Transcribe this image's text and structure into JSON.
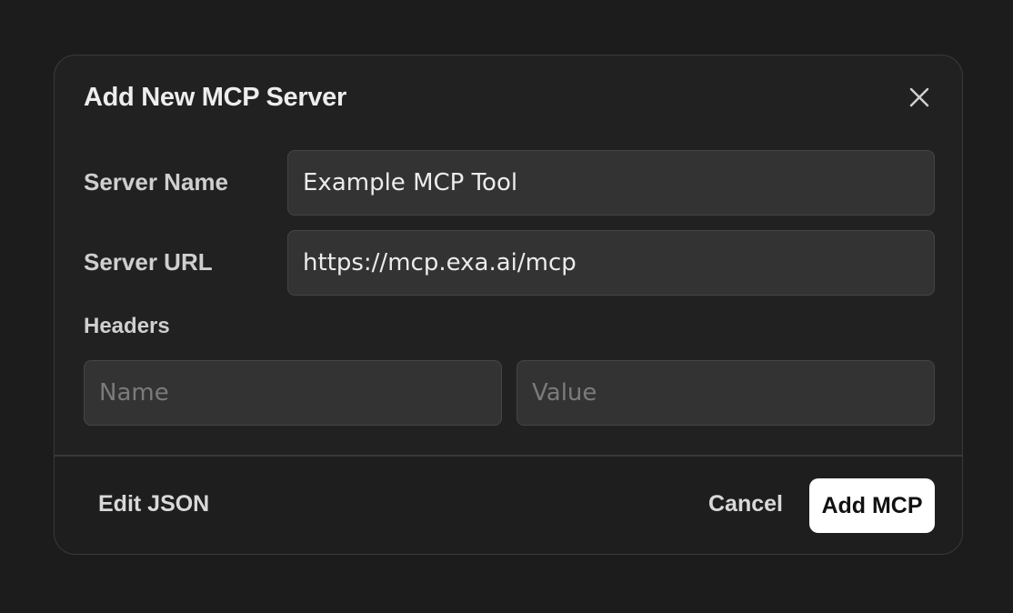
{
  "dialog": {
    "title": "Add New MCP Server",
    "close_icon": "close-icon"
  },
  "form": {
    "server_name": {
      "label": "Server Name",
      "value": "Example MCP Tool"
    },
    "server_url": {
      "label": "Server URL",
      "value": "https://mcp.exa.ai/mcp"
    },
    "headers": {
      "label": "Headers",
      "name_placeholder": "Name",
      "value_placeholder": "Value",
      "name_value": "",
      "value_value": ""
    }
  },
  "footer": {
    "edit_json_label": "Edit JSON",
    "cancel_label": "Cancel",
    "submit_label": "Add MCP"
  },
  "colors": {
    "background": "#1c1c1c",
    "dialog": "#212121",
    "input": "#333333",
    "primary_button": "#ffffff"
  }
}
